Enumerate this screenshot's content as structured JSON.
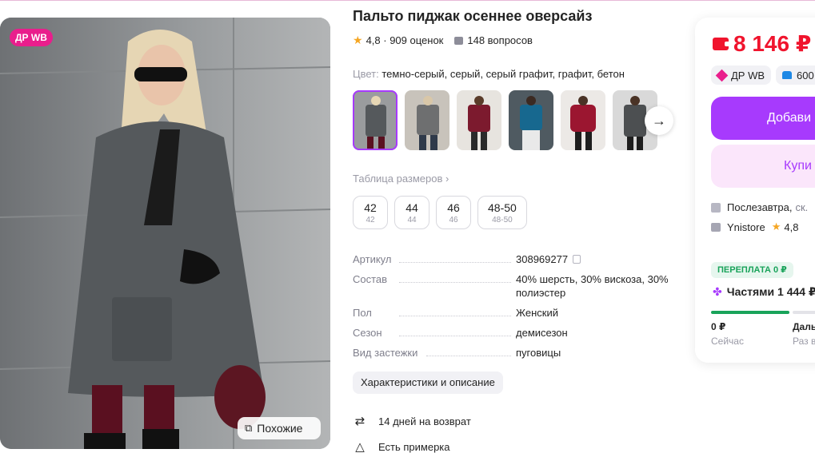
{
  "product": {
    "title": "Пальто пиджак осеннее оверсайз",
    "rating": "4,8",
    "reviews": "909 оценок",
    "questions": "148 вопросов",
    "color_label": "Цвет:",
    "color_value": "темно-серый, серый, серый графит, графит, бетон"
  },
  "gallery": {
    "badge": "ДР WB",
    "similar_label": "Похожие"
  },
  "sizes": {
    "table_label": "Таблица размеров",
    "items": [
      {
        "size": "42",
        "ru": "42"
      },
      {
        "size": "44",
        "ru": "44"
      },
      {
        "size": "46",
        "ru": "46"
      },
      {
        "size": "48-50",
        "ru": "48-50"
      }
    ]
  },
  "specs": [
    {
      "key": "Артикул",
      "value": "308969277"
    },
    {
      "key": "Состав",
      "value": "40% шерсть, 30% вискоза, 30% полиэстер"
    },
    {
      "key": "Пол",
      "value": "Женский"
    },
    {
      "key": "Сезон",
      "value": "демисезон"
    },
    {
      "key": "Вид застежки",
      "value": "пуговицы"
    }
  ],
  "chars_button": "Характеристики и описание",
  "perks": {
    "return": "14 дней на возврат",
    "fitting": "Есть примерка"
  },
  "card": {
    "price": "8 146 ₽",
    "chip_dr": "ДР WB",
    "chip_bonus": "600",
    "add_button": "Добави",
    "buy_button": "Купи",
    "delivery": "Послезавтра,",
    "delivery_more": "ск.",
    "store": "Ynistore",
    "store_rating": "4,8",
    "overpay": "ПЕРЕПЛАТА 0 ₽",
    "parts": "Частями 1 444 ₽",
    "pay_now_amount": "0 ₽",
    "pay_now_label": "Сейчас",
    "pay_later_amount": "Даль",
    "pay_later_label": "Раз в"
  },
  "colors": {
    "accent": "#a73afd",
    "price": "#f0142d",
    "badge": "#e91e8c",
    "success": "#19a35a"
  },
  "icons": [
    "star-icon",
    "question-icon",
    "copy-icon",
    "arrow-right-icon",
    "return-icon",
    "hanger-icon",
    "wallet-icon",
    "box-icon",
    "store-icon",
    "similar-icon"
  ]
}
